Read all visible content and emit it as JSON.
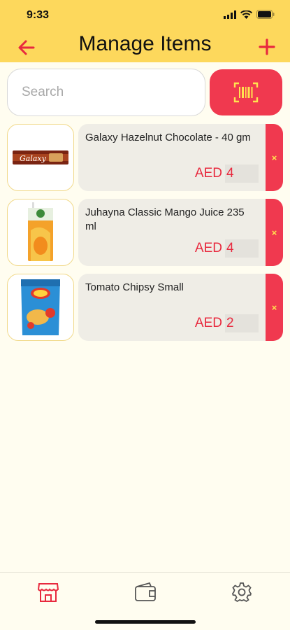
{
  "status_bar": {
    "time": "9:33"
  },
  "header": {
    "title": "Manage Items",
    "back_icon": "arrow-left-icon",
    "add_icon": "plus-icon"
  },
  "search": {
    "placeholder": "Search",
    "value": ""
  },
  "scan_button": {
    "icon": "barcode-icon"
  },
  "items": [
    {
      "name": "Galaxy Hazelnut Chocolate - 40 gm",
      "currency": "AED",
      "qty": "4",
      "image": "galaxy-chocolate-bar"
    },
    {
      "name": "Juhayna Classic Mango Juice 235 ml",
      "currency": "AED",
      "qty": "4",
      "image": "mango-juice-carton"
    },
    {
      "name": "Tomato Chipsy Small",
      "currency": "AED",
      "qty": "2",
      "image": "chipsy-bag"
    }
  ],
  "delete_label": "×",
  "tabs": [
    {
      "icon": "store-icon",
      "active": true
    },
    {
      "icon": "wallet-icon",
      "active": false
    },
    {
      "icon": "gear-icon",
      "active": false
    }
  ],
  "colors": {
    "header_bg": "#fdd85c",
    "accent": "#f0394f",
    "price_text": "#e8293e",
    "page_bg": "#fffdf0",
    "card_bg": "#efede6"
  }
}
